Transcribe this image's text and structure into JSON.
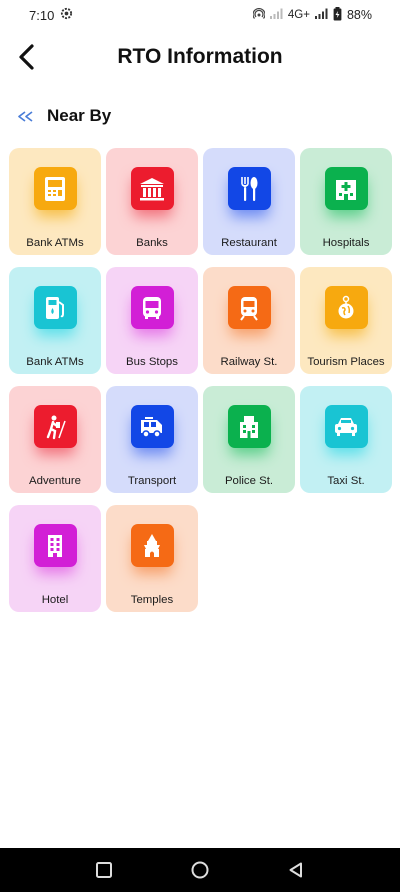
{
  "status_bar": {
    "time": "7:10",
    "network": "4G+",
    "battery": "88%"
  },
  "header": {
    "title": "RTO Information"
  },
  "section": {
    "title": "Near By"
  },
  "tiles": [
    {
      "label": "Bank ATMs",
      "icon": "atm-icon",
      "bg": "#fde8c0",
      "icon_bg": "#f7a90f",
      "glow": "#f7c04a"
    },
    {
      "label": "Banks",
      "icon": "bank-icon",
      "bg": "#fcd3d4",
      "icon_bg": "#ec1c2e",
      "glow": "#f2737e"
    },
    {
      "label": "Restaurant",
      "icon": "fork-knife-icon",
      "bg": "#d5dcfb",
      "icon_bg": "#1247e6",
      "glow": "#6e8cf2"
    },
    {
      "label": "Hospitals",
      "icon": "hospital-icon",
      "bg": "#c9ecd6",
      "icon_bg": "#0bb14e",
      "glow": "#5ed08c"
    },
    {
      "label": "Bank ATMs",
      "icon": "fuel-pump-icon",
      "bg": "#c2f0f3",
      "icon_bg": "#19c4d3",
      "glow": "#5ee0ea"
    },
    {
      "label": "Bus Stops",
      "icon": "bus-icon",
      "bg": "#f6d4f6",
      "icon_bg": "#d21fd6",
      "glow": "#e679e8"
    },
    {
      "label": "Railway St.",
      "icon": "train-icon",
      "bg": "#fcdcc9",
      "icon_bg": "#f56a15",
      "glow": "#f7a06b"
    },
    {
      "label": "Tourism Places",
      "icon": "globe-icon",
      "bg": "#fde8c0",
      "icon_bg": "#f7a90f",
      "glow": "#f7c04a"
    },
    {
      "label": "Adventure",
      "icon": "hiker-icon",
      "bg": "#fcd3d4",
      "icon_bg": "#ec1c2e",
      "glow": "#f2737e"
    },
    {
      "label": "Transport",
      "icon": "truck-icon",
      "bg": "#d5dcfb",
      "icon_bg": "#1247e6",
      "glow": "#6e8cf2"
    },
    {
      "label": "Police St.",
      "icon": "police-station-icon",
      "bg": "#c9ecd6",
      "icon_bg": "#0bb14e",
      "glow": "#5ed08c"
    },
    {
      "label": "Taxi St.",
      "icon": "taxi-icon",
      "bg": "#c2f0f3",
      "icon_bg": "#19c4d3",
      "glow": "#5ee0ea"
    },
    {
      "label": "Hotel",
      "icon": "hotel-icon",
      "bg": "#f6d4f6",
      "icon_bg": "#d21fd6",
      "glow": "#e679e8"
    },
    {
      "label": "Temples",
      "icon": "temple-icon",
      "bg": "#fcdcc9",
      "icon_bg": "#f56a15",
      "glow": "#f7a06b"
    }
  ],
  "nav_bar": {
    "buttons": [
      "recents-icon",
      "home-icon",
      "back-icon"
    ]
  }
}
